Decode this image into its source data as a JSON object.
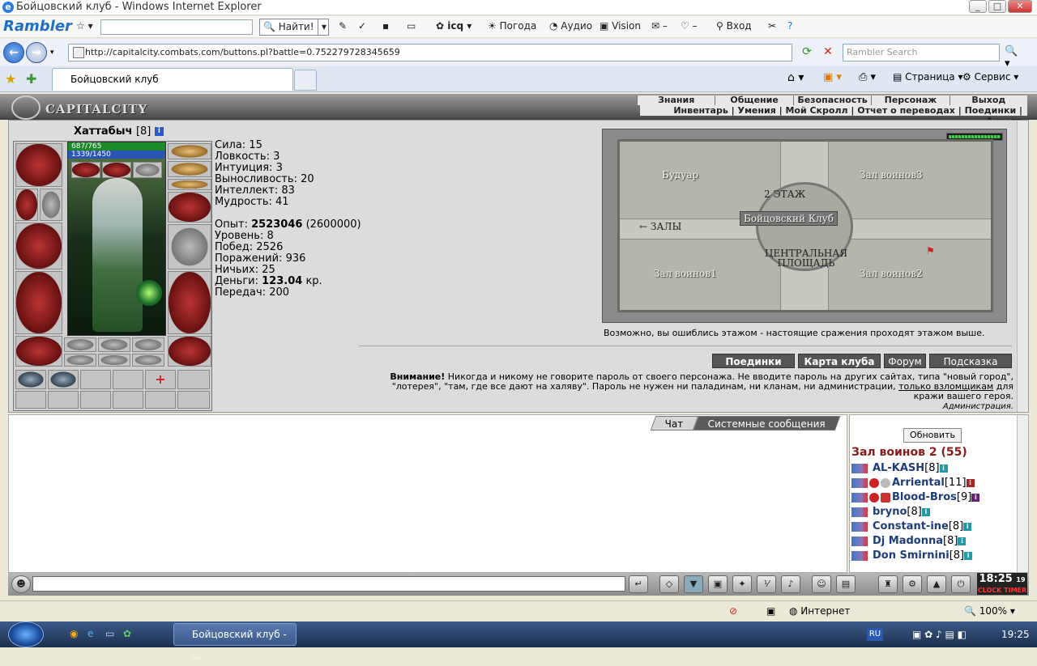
{
  "window": {
    "title": "Бойцовский клуб - Windows Internet Explorer"
  },
  "rambler": {
    "logo": "Rambler",
    "find": "Найти!",
    "icq": "icq",
    "weather": "Погода",
    "audio": "Аудио",
    "vision": "Vision",
    "login": "Вход"
  },
  "address": {
    "url": "http://capitalcity.combats.com/buttons.pl?battle=0.752279728345659",
    "search_placeholder": "Rambler Search"
  },
  "tabs": {
    "active": "Бойцовский клуб",
    "page_menu": "Страница",
    "service_menu": "Сервис"
  },
  "game": {
    "brand": "CAPITALCITY",
    "topnav": [
      "Знания",
      "Общение",
      "Безопасность",
      "Персонаж",
      "Выход"
    ],
    "subnav": "Инвентарь | Умения | Мой Скролл | Отчет о переводах | Поединки | Анкета",
    "character": {
      "name": "Хаттабыч",
      "level": "[8]",
      "hp": "687/765",
      "mana": "1339/1450"
    },
    "stats": [
      {
        "label": "Сила:",
        "value": "15"
      },
      {
        "label": "Ловкость:",
        "value": "3"
      },
      {
        "label": "Интуиция:",
        "value": "3"
      },
      {
        "label": "Выносливость:",
        "value": "20"
      },
      {
        "label": "Интеллект:",
        "value": "83"
      },
      {
        "label": "Мудрость:",
        "value": "41"
      }
    ],
    "experience": {
      "label": "Опыт:",
      "value": "2523046",
      "next": "(2600000)"
    },
    "records": [
      {
        "label": "Уровень:",
        "value": "8"
      },
      {
        "label": "Побед:",
        "value": "2526"
      },
      {
        "label": "Поражений:",
        "value": "936"
      },
      {
        "label": "Ничьих:",
        "value": "25"
      }
    ],
    "money": {
      "label": "Деньги:",
      "value": "123.04",
      "unit": "кр."
    },
    "transfers": {
      "label": "Передач:",
      "value": "200"
    },
    "map": {
      "rooms": {
        "boudoir": "Будуар",
        "hall3": "Зал воинов3",
        "floor2": "2 ЭТАЖ",
        "club": "Бойцовский Клуб",
        "halls": "← ЗАЛЫ",
        "square": "ЦЕНТРАЛЬНАЯ ПЛОЩАДЬ",
        "hall1": "Зал воинов1",
        "hall2": "Зал воинов2"
      },
      "note": "Возможно, вы ошиблись этажом - настоящие сражения проходят этажом выше."
    },
    "buttons": {
      "fights": "Поединки",
      "club_map": "Карта клуба",
      "forum": "Форум",
      "hint": "Подсказка"
    },
    "warning": {
      "bold": "Внимание!",
      "text": "Никогда и никому не говорите пароль от своего персонажа. Не вводите пароль на других сайтах, типа \"новый город\", \"лотерея\", \"там, где все дают на халяву\". Пароль не нужен ни паладинам, ни кланам, ни администрации,",
      "link": "только взломщикам",
      "tail": "для кражи вашего героя.",
      "sign": "Администрация."
    }
  },
  "chat": {
    "tabs": [
      "Чат",
      "Системные сообщения"
    ],
    "refresh": "Обновить",
    "room": "Зал воинов 2 (55)",
    "players": [
      {
        "name": "AL-KASH",
        "level": "[8]"
      },
      {
        "name": "Arriental",
        "level": "[11]"
      },
      {
        "name": "Blood-Bros",
        "level": "[9]"
      },
      {
        "name": "bryno",
        "level": "[8]"
      },
      {
        "name": "Constant-ine",
        "level": "[8]"
      },
      {
        "name": "Dj Madonna",
        "level": "[8]"
      },
      {
        "name": "Don Smirnini",
        "level": "[8]"
      }
    ]
  },
  "clock": {
    "time": "18:25",
    "sec": "19",
    "label": "CLOCK TIMER"
  },
  "statusbar": {
    "zone": "Интернет",
    "zoom": "100%"
  },
  "taskbar": {
    "item": "Бойцовский клуб - ...",
    "lang": "RU",
    "time": "19:25"
  }
}
